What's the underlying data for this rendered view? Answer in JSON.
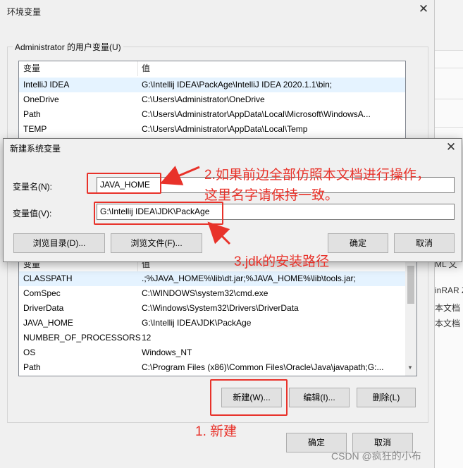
{
  "env_dialog": {
    "title": "环境变量",
    "close_glyph": "✕",
    "user_group_label": "Administrator 的用户变量(U)",
    "user_headers": [
      "变量",
      "值"
    ],
    "user_rows": [
      {
        "name": "IntelliJ IDEA",
        "value": "G:\\Intellij IDEA\\PackAge\\IntelliJ IDEA 2020.1.1\\bin;",
        "selected": true
      },
      {
        "name": "OneDrive",
        "value": "C:\\Users\\Administrator\\OneDrive",
        "selected": false
      },
      {
        "name": "Path",
        "value": "C:\\Users\\Administrator\\AppData\\Local\\Microsoft\\WindowsA...",
        "selected": false
      },
      {
        "name": "TEMP",
        "value": "C:\\Users\\Administrator\\AppData\\Local\\Temp",
        "selected": false
      }
    ],
    "system_headers": [
      "变量",
      "值"
    ],
    "system_rows": [
      {
        "name": "CLASSPATH",
        "value": ".;%JAVA_HOME%\\lib\\dt.jar;%JAVA_HOME%\\lib\\tools.jar;",
        "selected": true
      },
      {
        "name": "ComSpec",
        "value": "C:\\WINDOWS\\system32\\cmd.exe",
        "selected": false
      },
      {
        "name": "DriverData",
        "value": "C:\\Windows\\System32\\Drivers\\DriverData",
        "selected": false
      },
      {
        "name": "JAVA_HOME",
        "value": "G:\\Intellij IDEA\\JDK\\PackAge",
        "selected": false
      },
      {
        "name": "NUMBER_OF_PROCESSORS",
        "value": "12",
        "selected": false
      },
      {
        "name": "OS",
        "value": "Windows_NT",
        "selected": false
      },
      {
        "name": "Path",
        "value": "C:\\Program Files (x86)\\Common Files\\Oracle\\Java\\javapath;G:...",
        "selected": false
      }
    ],
    "system_buttons": {
      "new": "新建(W)...",
      "edit": "编辑(I)...",
      "delete": "删除(L)"
    },
    "ok": "确定",
    "cancel": "取消"
  },
  "new_var_dialog": {
    "title": "新建系统变量",
    "close_glyph": "✕",
    "name_label": "变量名(N):",
    "name_value": "JAVA_HOME",
    "value_label": "变量值(V):",
    "value_value": "G:\\Intellij IDEA\\JDK\\PackAge",
    "browse_dir": "浏览目录(D)...",
    "browse_file": "浏览文件(F)...",
    "ok": "确定",
    "cancel": "取消"
  },
  "annotations": {
    "note2_line1": "2.如果前边全部仿照本文档进行操作，",
    "note2_line2": "这里名字请保持一致。",
    "note3": "3.jdk的安装路径",
    "note1": "1. 新建",
    "color": "#e8322a"
  },
  "background_window": {
    "fragments": [
      "ML 文",
      "inRAR Z",
      "本文档",
      "本文档"
    ]
  },
  "watermark": "CSDN @疯狂的小布"
}
